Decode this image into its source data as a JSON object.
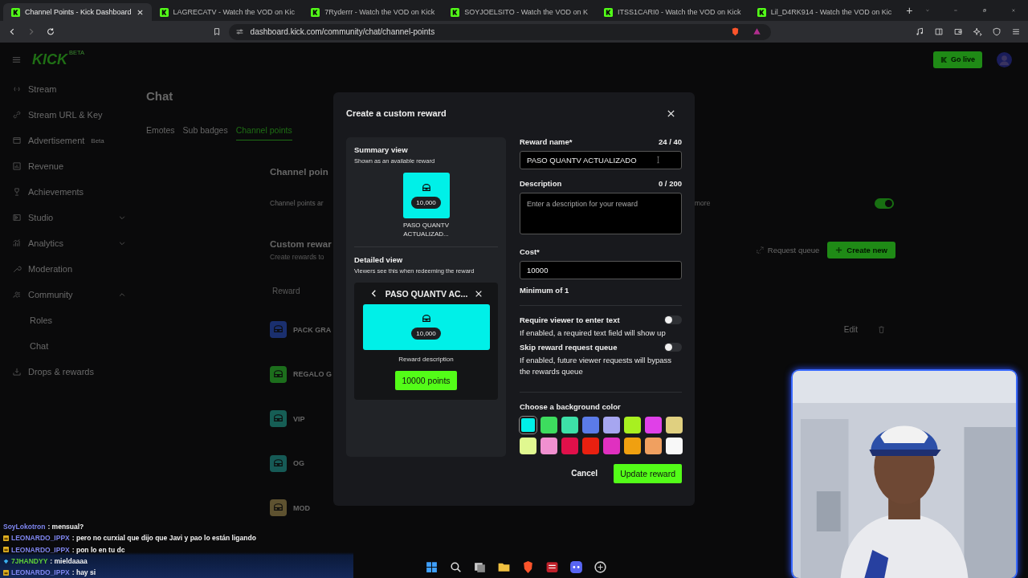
{
  "browser": {
    "tabs": [
      {
        "title": "Channel Points - Kick Dashboard",
        "selected": true
      },
      {
        "title": "LAGRECATV - Watch the VOD on Kic",
        "selected": false
      },
      {
        "title": "7Ryderrr - Watch the VOD on Kick",
        "selected": false
      },
      {
        "title": "SOYJOELSITO - Watch the VOD on K",
        "selected": false
      },
      {
        "title": "ITSS1CARI0 - Watch the VOD on Kick",
        "selected": false
      },
      {
        "title": "Lil_D4RK914 - Watch the VOD on Kic",
        "selected": false
      }
    ],
    "new_tab": "+",
    "url": "dashboard.kick.com/community/chat/channel-points"
  },
  "header": {
    "logo": "KICK",
    "logo_badge": "BETA",
    "go_live": "Go live"
  },
  "sidebar": {
    "items": [
      {
        "label": "Stream"
      },
      {
        "label": "Stream URL & Key"
      },
      {
        "label": "Advertisement",
        "badge": "Beta"
      },
      {
        "label": "Revenue"
      },
      {
        "label": "Achievements"
      },
      {
        "label": "Studio",
        "expanded": false
      },
      {
        "label": "Analytics",
        "expanded": false
      },
      {
        "label": "Moderation"
      },
      {
        "label": "Community",
        "expanded": true,
        "children": [
          {
            "label": "Roles"
          },
          {
            "label": "Chat"
          }
        ]
      },
      {
        "label": "Drops & rewards"
      }
    ]
  },
  "page": {
    "title": "Chat",
    "tabs": [
      {
        "label": "Emotes",
        "selected": false
      },
      {
        "label": "Sub badges",
        "selected": false
      },
      {
        "label": "Channel points",
        "selected": true
      }
    ],
    "section_title": "Channel poin",
    "section_text": "Channel points ar",
    "section_more": "more",
    "channel_points_toggle": {
      "on": true
    },
    "custom_title": "Custom rewar",
    "custom_subtitle": "Create rewards to",
    "request_queue": "Request queue",
    "create_new": "Create new",
    "column_header": "Reward",
    "rewards": [
      {
        "name": "PACK GRA",
        "color": "#1a2f6e",
        "action": "Edit"
      },
      {
        "name": "REGALO G",
        "color": "#1c6e1c"
      },
      {
        "name": "VIP",
        "color": "#165e55"
      },
      {
        "name": "OG",
        "color": "#165a56"
      },
      {
        "name": "MOD",
        "color": "#5e5230"
      }
    ]
  },
  "modal": {
    "title": "Create a custom reward",
    "summary": {
      "title": "Summary view",
      "subtitle": "Shown as an available reward",
      "cost": "10,000",
      "name": "PASO QUANTV ACTUALIZAD..."
    },
    "detailed": {
      "title": "Detailed view",
      "subtitle": "Viewers see this when redeeming the reward",
      "name": "PASO QUANTV AC...",
      "cost": "10,000",
      "description": "Reward description",
      "button": "10000 points"
    },
    "name_label": "Reward name*",
    "name_count": "24 / 40",
    "name_value": "PASO QUANTV ACTUALIZADO",
    "description_label": "Description",
    "description_count": "0 / 200",
    "description_placeholder": "Enter a description for your reward",
    "cost_label": "Cost*",
    "cost_value": "10000",
    "cost_hint": "Minimum of 1",
    "toggles": [
      {
        "title": "Require viewer to enter text",
        "text": "If enabled, a required text field will show up",
        "on": false
      },
      {
        "title": "Skip reward request queue",
        "text": "If enabled, future viewer requests will bypass the rewards queue",
        "on": false
      }
    ],
    "color_label": "Choose a background color",
    "colors": [
      {
        "color": "#00f0e8",
        "selected": true
      },
      {
        "color": "#3ddc5e",
        "selected": false
      },
      {
        "color": "#3de0a8",
        "selected": false
      },
      {
        "color": "#5b7be8",
        "selected": false
      },
      {
        "color": "#a6a6f0",
        "selected": false
      },
      {
        "color": "#a8f020",
        "selected": false
      },
      {
        "color": "#e040e8",
        "selected": false
      },
      {
        "color": "#e0d080",
        "selected": false
      },
      {
        "color": "#e0f890",
        "selected": false
      },
      {
        "color": "#f090d0",
        "selected": false
      },
      {
        "color": "#e0104a",
        "selected": false
      },
      {
        "color": "#e82010",
        "selected": false
      },
      {
        "color": "#e030c0",
        "selected": false
      },
      {
        "color": "#f0a010",
        "selected": false
      },
      {
        "color": "#f0a060",
        "selected": false
      },
      {
        "color": "#f8f8f8",
        "selected": false
      }
    ],
    "cancel": "Cancel",
    "submit": "Update reward"
  },
  "chat": [
    {
      "user": "SoyLokotron",
      "color": "#7f86f0",
      "message": ": mensual?"
    },
    {
      "user": "LEONARDO_IPPX",
      "color": "#7f86f0",
      "kind": "crown",
      "message": ": pero no curxial que dijo que Javi y pao lo están ligando"
    },
    {
      "user": "LEONARDO_IPPX",
      "color": "#7f86f0",
      "kind": "crown",
      "message": ": pon lo en tu dc"
    },
    {
      "user": "7JHANDYY",
      "color": "#5fd038",
      "kind": "gem",
      "message": ": mieldaaaa"
    },
    {
      "user": "LEONARDO_IPPX",
      "color": "#7f86f0",
      "kind": "crown",
      "message": ": hay si"
    }
  ]
}
